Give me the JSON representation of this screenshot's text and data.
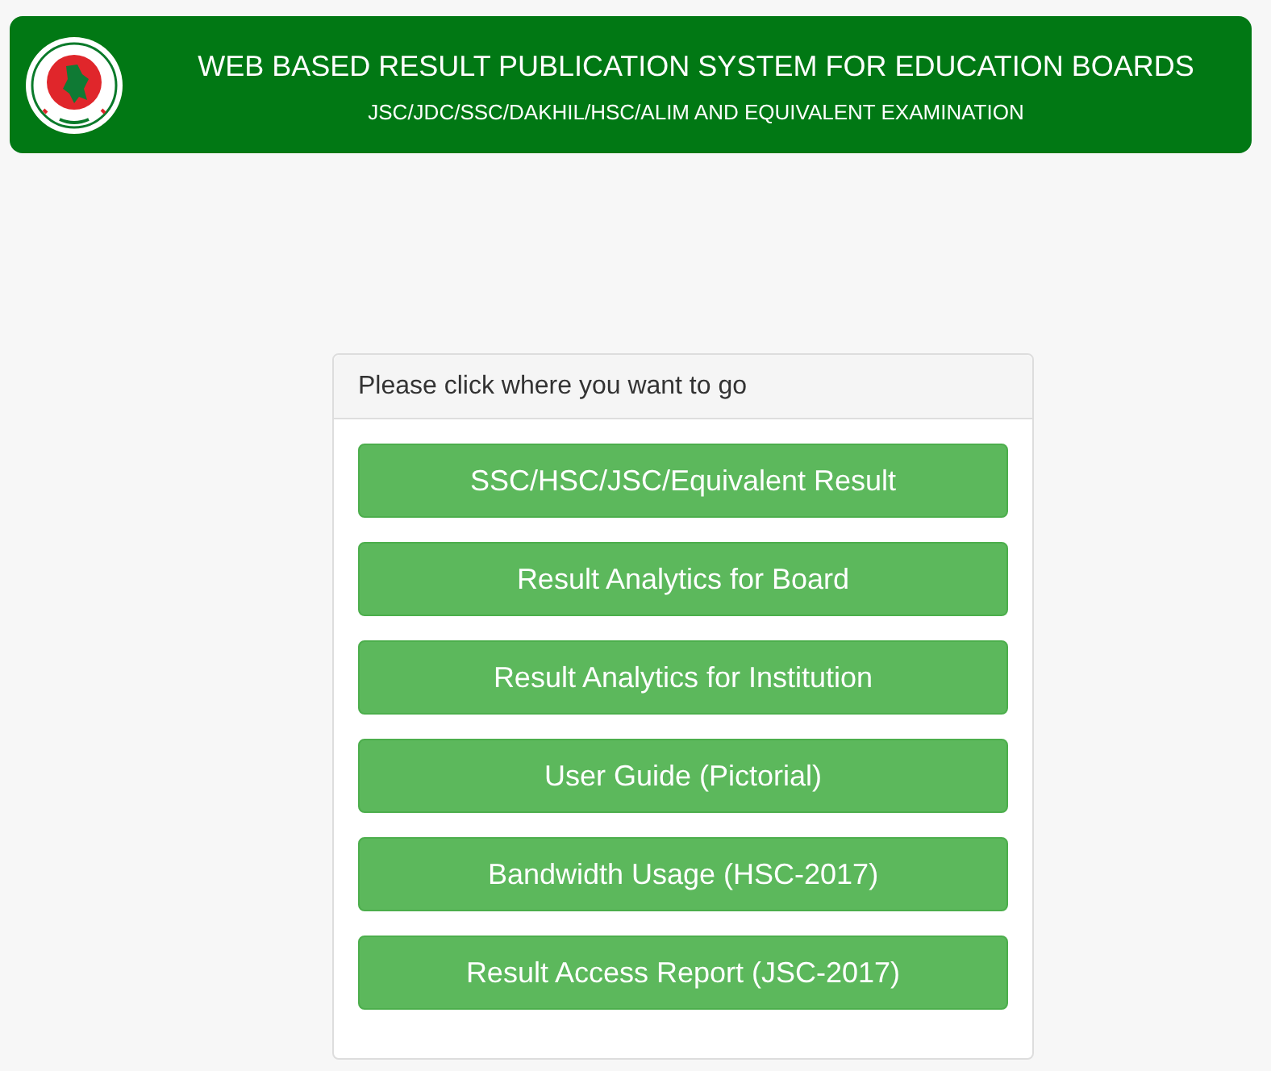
{
  "header": {
    "title": "WEB BASED RESULT PUBLICATION SYSTEM FOR EDUCATION BOARDS",
    "subtitle": "JSC/JDC/SSC/DAKHIL/HSC/ALIM AND EQUIVALENT EXAMINATION"
  },
  "panel": {
    "heading": "Please click where you want to go",
    "links": [
      "SSC/HSC/JSC/Equivalent Result",
      "Result Analytics for Board",
      "Result Analytics for Institution",
      "User Guide (Pictorial)",
      "Bandwidth Usage (HSC-2017)",
      "Result Access Report (JSC-2017)"
    ]
  }
}
